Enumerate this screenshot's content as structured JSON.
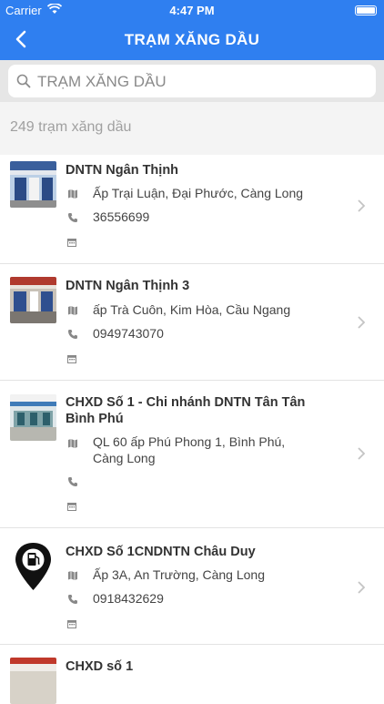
{
  "status": {
    "carrier": "Carrier",
    "time": "4:47 PM"
  },
  "nav": {
    "title": "TRẠM XĂNG DẦU"
  },
  "search": {
    "placeholder": "TRẠM XĂNG DẦU",
    "value": ""
  },
  "count_label": "249 trạm xăng dầu",
  "colors": {
    "accent": "#2f7ff0",
    "separator": "#e3e3e3"
  },
  "stations": [
    {
      "name": "DNTN Ngân Thịnh",
      "address": "Ấp Trại Luận, Đại Phước, Càng Long",
      "phone": "36556699",
      "schedule": "",
      "thumb": "photo"
    },
    {
      "name": "DNTN Ngân Thịnh 3",
      "address": "ấp Trà Cuôn, Kim Hòa, Cầu Ngang",
      "phone": "0949743070",
      "schedule": "",
      "thumb": "photo"
    },
    {
      "name": "CHXD Số 1 - Chi nhánh DNTN Tân Tân Bình Phú",
      "address": "QL 60  ấp Phú Phong 1, Bình Phú, Càng Long",
      "phone": "",
      "schedule": "",
      "thumb": "photo"
    },
    {
      "name": "CHXD Số 1CNDNTN Châu Duy",
      "address": "Ấp 3A, An Trường, Càng Long",
      "phone": "0918432629",
      "schedule": "",
      "thumb": "fuel-pin-icon"
    },
    {
      "name": "CHXD số 1",
      "address": "",
      "phone": "",
      "schedule": "",
      "thumb": "photo"
    }
  ]
}
